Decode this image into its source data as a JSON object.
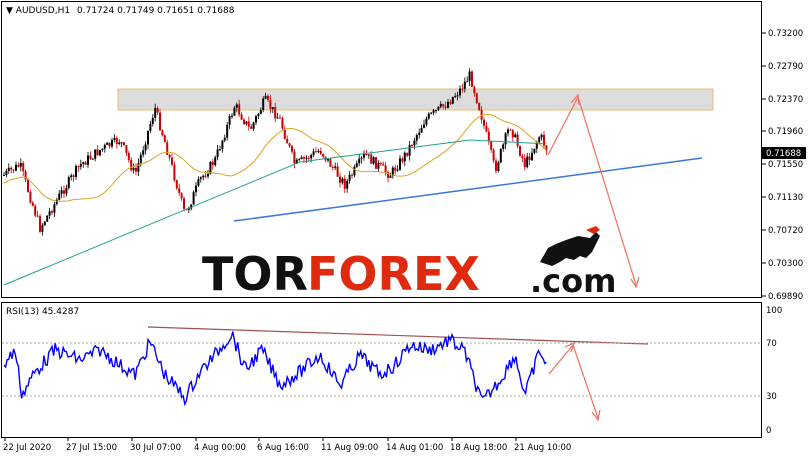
{
  "header": {
    "symbol": "AUDUSD,H1",
    "ohlc": "0.71724 0.71749 0.71651 0.71688"
  },
  "price_axis": {
    "labels": [
      "0.73200",
      "0.72790",
      "0.72370",
      "0.71960",
      "0.71550",
      "0.71130",
      "0.70720",
      "0.70300",
      "0.69890"
    ],
    "current_price": "0.71688"
  },
  "rsi": {
    "label": "RSI(13) 45.4287",
    "levels": [
      "100",
      "70",
      "30",
      "0"
    ]
  },
  "time_axis": {
    "labels": [
      "22 Jul 2020",
      "27 Jul 15:00",
      "30 Jul 07:00",
      "4 Aug 00:00",
      "6 Aug 16:00",
      "11 Aug 09:00",
      "14 Aug 01:00",
      "18 Aug 18:00",
      "21 Aug 10:00"
    ]
  },
  "logo": {
    "part1": "TOR",
    "part2": "FOREX",
    "part3": ".com"
  },
  "colors": {
    "bull_candle": "#000000",
    "bear_candle": "#cc0000",
    "ma_fast": "#e0a020",
    "ma_slow": "#20a090",
    "rsi_line": "#0000ff",
    "trendline": "#3a78d8",
    "arrow": "#f07060",
    "resistance_zone": "#d8d8d8"
  },
  "chart_data": {
    "type": "candlestick",
    "price_ylim": [
      0.6989,
      0.7341
    ],
    "rsi_ylim": [
      0,
      100
    ],
    "key_closes": [
      {
        "x": "22 Jul 2020",
        "y": 0.7155
      },
      {
        "x": "27 Jul 15:00",
        "y": 0.716
      },
      {
        "x": "30 Jul 07:00",
        "y": 0.7225
      },
      {
        "x": "4 Aug 00:00",
        "y": 0.7237
      },
      {
        "x": "6 Aug 16:00",
        "y": 0.7237
      },
      {
        "x": "11 Aug 09:00",
        "y": 0.7175
      },
      {
        "x": "14 Aug 01:00",
        "y": 0.7165
      },
      {
        "x": "18 Aug 18:00",
        "y": 0.727
      },
      {
        "x": "21 Aug 10:00",
        "y": 0.7169
      }
    ]
  }
}
